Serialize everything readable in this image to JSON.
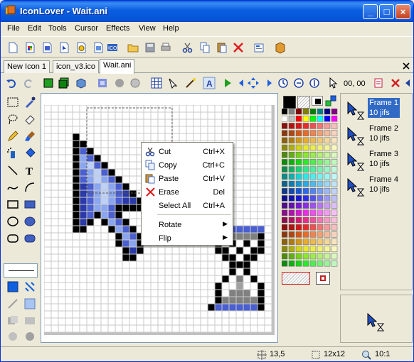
{
  "window": {
    "title": "IconLover - Wait.ani"
  },
  "menu": [
    "File",
    "Edit",
    "Tools",
    "Cursor",
    "Effects",
    "View",
    "Help"
  ],
  "tabs": [
    {
      "label": "New Icon 1",
      "active": false
    },
    {
      "label": "icon_v3.ico",
      "active": false
    },
    {
      "label": "Wait.ani",
      "active": true
    }
  ],
  "toolbar2": {
    "coords": "00, 00"
  },
  "context_menu": {
    "items": [
      {
        "label": "Cut",
        "shortcut": "Ctrl+X",
        "icon": "scissors-icon"
      },
      {
        "label": "Copy",
        "shortcut": "Ctrl+C",
        "icon": "copy-icon"
      },
      {
        "label": "Paste",
        "shortcut": "Ctrl+V",
        "icon": "paste-icon"
      },
      {
        "label": "Erase",
        "shortcut": "Del",
        "icon": "red-x-icon"
      },
      {
        "label": "Select All",
        "shortcut": "Ctrl+A",
        "icon": ""
      },
      {
        "label": "Rotate",
        "shortcut": "",
        "icon": "",
        "submenu": true
      },
      {
        "label": "Flip",
        "shortcut": "",
        "icon": "",
        "submenu": true
      }
    ]
  },
  "frames": [
    {
      "title": "Frame 1",
      "duration": "10 jifs",
      "selected": true
    },
    {
      "title": "Frame 2",
      "duration": "10 jifs",
      "selected": false
    },
    {
      "title": "Frame 3",
      "duration": "10 jifs",
      "selected": false
    },
    {
      "title": "Frame 4",
      "duration": "10 jifs",
      "selected": false
    }
  ],
  "status": {
    "position": "13,5",
    "selection_size": "12x12",
    "zoom": "10:1"
  },
  "colors": {
    "selection": "#316ac5",
    "title_bar": "#0654d8"
  }
}
